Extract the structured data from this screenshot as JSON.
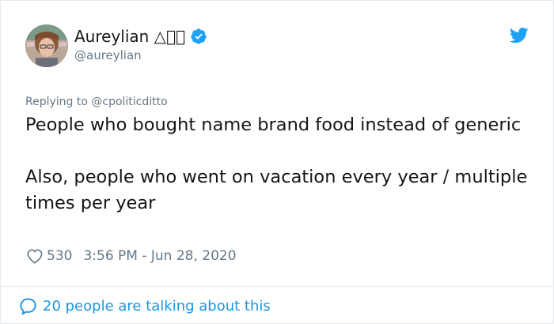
{
  "user": {
    "display_name": "Aureylian △⃞⃞",
    "handle": "@aureylian",
    "verified": true,
    "avatar_icon": "profile-photo"
  },
  "brand": {
    "logo_icon": "twitter-bird-icon",
    "accent_color": "#1da1f2"
  },
  "tweet": {
    "replying_to": "Replying to @cpoliticditto",
    "paragraph_1": "People who bought name brand food instead of generic",
    "paragraph_2": "Also, people who went on vacation every year / multiple times per year",
    "like_count": "530",
    "timestamp": "3:56 PM - Jun 28, 2020"
  },
  "footer": {
    "talking_text": "20 people are talking about this",
    "link_color": "#1b95e0"
  }
}
